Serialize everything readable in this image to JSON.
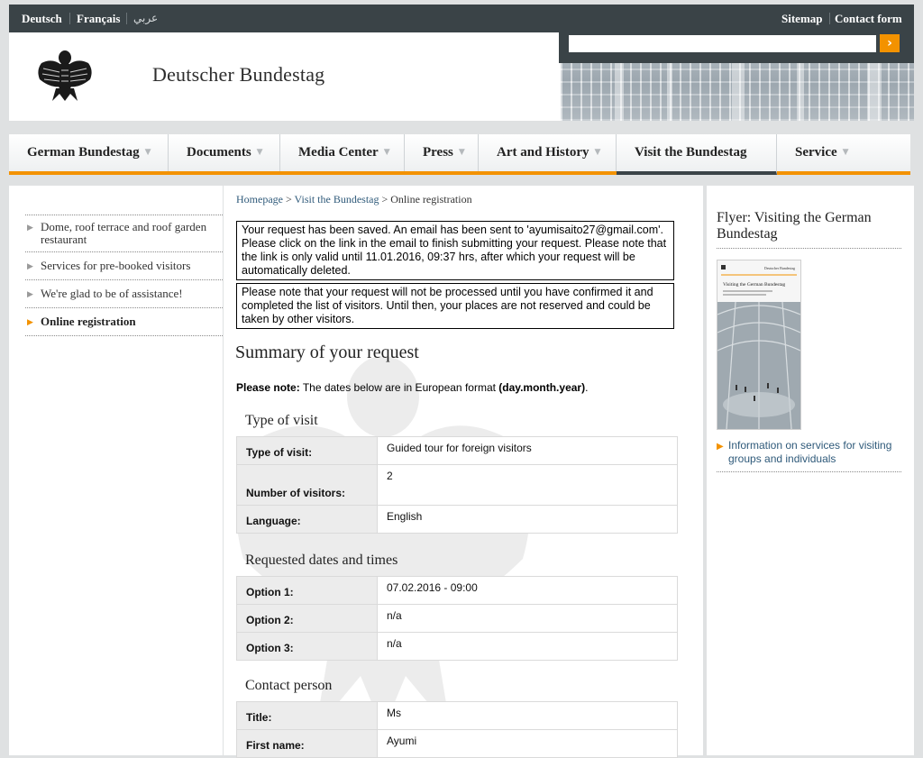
{
  "topbar": {
    "languages": [
      "Deutsch",
      "Français",
      "عربي"
    ],
    "links": [
      "Sitemap",
      "Contact form"
    ]
  },
  "header": {
    "site_title": "Deutscher Bundestag",
    "search_placeholder": "",
    "search_button": "›"
  },
  "nav": {
    "items": [
      {
        "label": "German Bundestag",
        "active": false
      },
      {
        "label": "Documents",
        "active": false
      },
      {
        "label": "Media Center",
        "active": false
      },
      {
        "label": "Press",
        "active": false
      },
      {
        "label": "Art and History",
        "active": false
      },
      {
        "label": "Visit the Bundestag",
        "active": true
      },
      {
        "label": "Service",
        "active": false
      }
    ],
    "caret": "▼"
  },
  "sidebar": {
    "items": [
      {
        "label": "Dome, roof terrace and roof garden restaurant",
        "active": false
      },
      {
        "label": "Services for pre-booked visitors",
        "active": false
      },
      {
        "label": "We're glad to be of assistance!",
        "active": false
      },
      {
        "label": "Online registration",
        "active": true
      }
    ],
    "arrow": "▶"
  },
  "breadcrumb": {
    "home": "Homepage",
    "sep1": " > ",
    "parent": "Visit the Bundestag",
    "sep2": " > ",
    "current": "Online registration"
  },
  "notices": {
    "saved": "Your request has been saved. An email has been sent to 'ayumisaito27@gmail.com'. Please click on the link in the email to finish submitting your request. Please note that the link is only valid until 11.01.2016, 09:37 hrs, after which your request will be automatically deleted.",
    "confirm": "Please note that your request will not be processed until you have confirmed it and completed the list of visitors. Until then, your places are not reserved and could be taken by other visitors."
  },
  "summary": {
    "title": "Summary of your request",
    "note_label": "Please note:",
    "note_text": " The dates below are in European format ",
    "note_format": "(day.month.year)",
    "note_end": "."
  },
  "sections": {
    "visit": {
      "title": "Type of visit",
      "rows": [
        {
          "label": "Type of visit:",
          "value": "Guided tour for foreign visitors"
        },
        {
          "label": "Number of visitors:",
          "value": "2"
        },
        {
          "label": "Language:",
          "value": "English"
        }
      ]
    },
    "dates": {
      "title": "Requested dates and times",
      "rows": [
        {
          "label": "Option 1:",
          "value": "07.02.2016 - 09:00"
        },
        {
          "label": "Option 2:",
          "value": "n/a"
        },
        {
          "label": "Option 3:",
          "value": "n/a"
        }
      ]
    },
    "contact": {
      "title": "Contact person",
      "rows": [
        {
          "label": "Title:",
          "value": "Ms"
        },
        {
          "label": "First name:",
          "value": "Ayumi"
        }
      ]
    }
  },
  "right": {
    "flyer_title": "Flyer: Visiting the German Bundestag",
    "flyer_cover_brand": "Deutscher Bundestag",
    "flyer_cover_title": "Visiting the German Bundestag",
    "link_arrow": "▶",
    "link_text": "Information on services for visiting groups and individuals"
  },
  "colors": {
    "accent": "#f39200",
    "dark": "#3a4347",
    "link": "#2f5a7a"
  }
}
